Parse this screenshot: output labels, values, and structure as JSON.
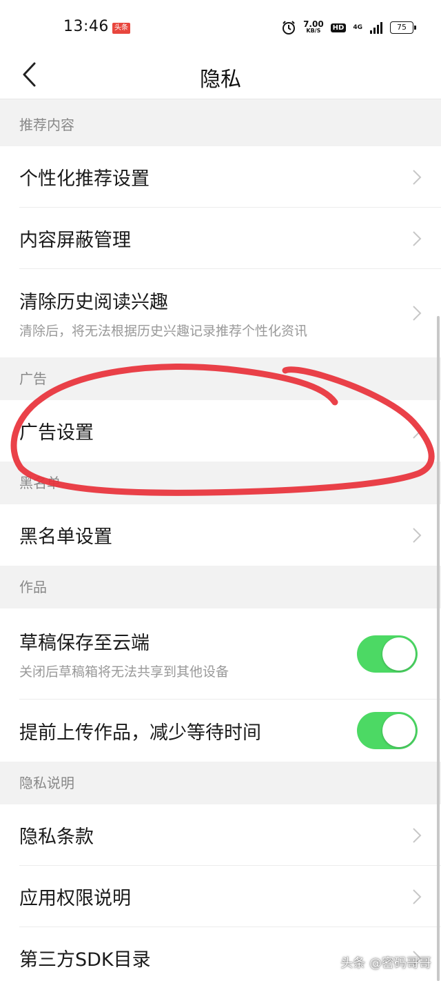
{
  "status_bar": {
    "time": "13:46",
    "app_badge": "头条",
    "net_speed": "7.00",
    "net_speed_unit": "KB/S",
    "hd": "HD",
    "network": "4G",
    "battery": "75"
  },
  "nav": {
    "title": "隐私"
  },
  "sections": {
    "recommend": {
      "header": "推荐内容",
      "personalized": "个性化推荐设置",
      "block_manage": "内容屏蔽管理",
      "clear_history": "清除历史阅读兴趣",
      "clear_history_sub": "清除后，将无法根据历史兴趣记录推荐个性化资讯"
    },
    "ads": {
      "header": "广告",
      "ad_settings": "广告设置"
    },
    "blacklist": {
      "header": "黑名单",
      "blacklist_settings": "黑名单设置"
    },
    "works": {
      "header": "作品",
      "draft_cloud": "草稿保存至云端",
      "draft_cloud_sub": "关闭后草稿箱将无法共享到其他设备",
      "draft_cloud_on": true,
      "pre_upload": "提前上传作品，减少等待时间",
      "pre_upload_on": true
    },
    "privacy_info": {
      "header": "隐私说明",
      "privacy_terms": "隐私条款",
      "app_permissions": "应用权限说明",
      "third_party_sdk": "第三方SDK目录"
    }
  },
  "colors": {
    "toggle_on": "#4cd964",
    "annotation": "#e8313a"
  },
  "watermark": "头条 @密码哥哥"
}
